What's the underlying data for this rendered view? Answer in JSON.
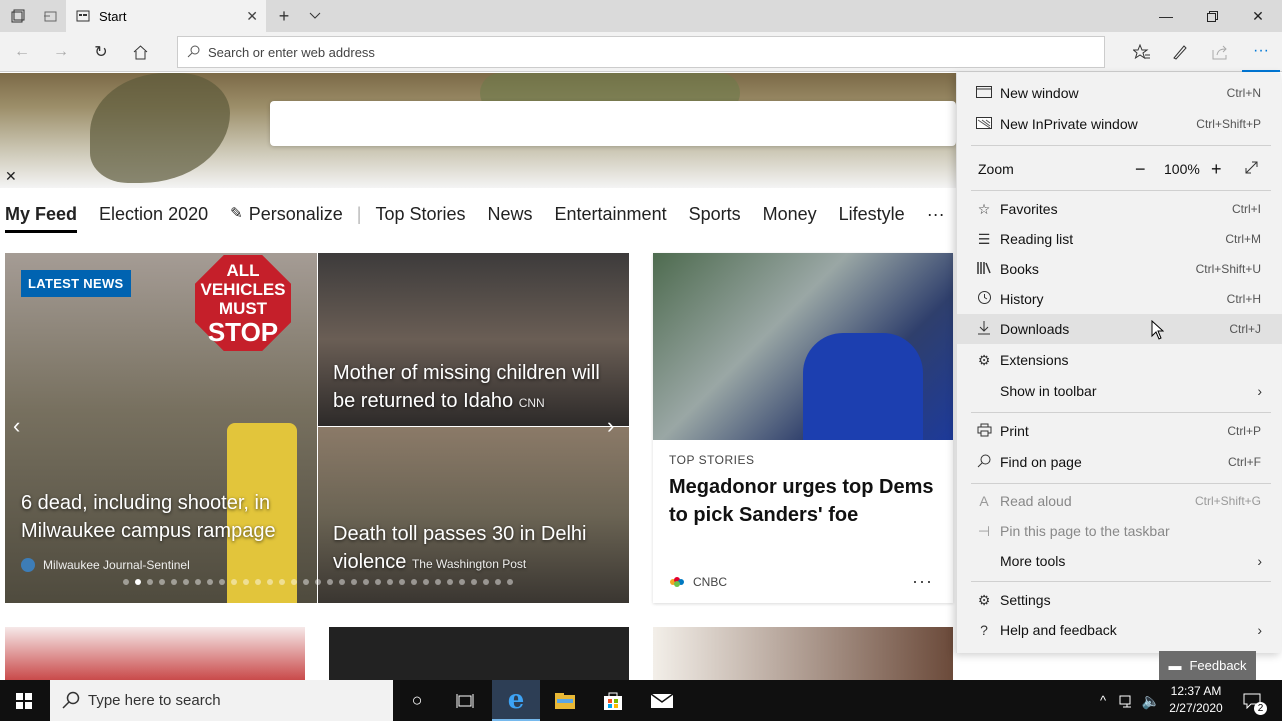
{
  "browser": {
    "tab_title": "Start",
    "address_placeholder": "Search or enter web address"
  },
  "feed": {
    "tabs": [
      "My Feed",
      "Election 2020",
      "Personalize",
      "Top Stories",
      "News",
      "Entertainment",
      "Sports",
      "Money",
      "Lifestyle",
      "···"
    ],
    "carousel": {
      "badge": "LATEST NEWS",
      "story1_title": "6 dead, including shooter, in Milwaukee campus rampage",
      "story1_source": "Milwaukee Journal-Sentinel",
      "story2_title": "Mother of missing children will be returned to Idaho",
      "story2_source": "CNN",
      "story3_title": "Death toll passes 30 in Delhi violence",
      "story3_source": "The Washington Post",
      "sign_line1": "ALL",
      "sign_line2": "VEHICLES",
      "sign_line3": "MUST",
      "sign_line4": "STOP"
    },
    "card": {
      "kicker": "TOP STORIES",
      "title": "Megadonor urges top Dems to pick Sanders' foe",
      "source": "CNBC",
      "more": "···"
    }
  },
  "menu": {
    "new_window": "New window",
    "new_window_sc": "Ctrl+N",
    "new_inprivate": "New InPrivate window",
    "new_inprivate_sc": "Ctrl+Shift+P",
    "zoom": "Zoom",
    "zoom_value": "100%",
    "favorites": "Favorites",
    "favorites_sc": "Ctrl+I",
    "reading_list": "Reading list",
    "reading_list_sc": "Ctrl+M",
    "books": "Books",
    "books_sc": "Ctrl+Shift+U",
    "history": "History",
    "history_sc": "Ctrl+H",
    "downloads": "Downloads",
    "downloads_sc": "Ctrl+J",
    "extensions": "Extensions",
    "show_in_toolbar": "Show in toolbar",
    "print": "Print",
    "print_sc": "Ctrl+P",
    "find": "Find on page",
    "find_sc": "Ctrl+F",
    "read_aloud": "Read aloud",
    "read_aloud_sc": "Ctrl+Shift+G",
    "pin": "Pin this page to the taskbar",
    "more_tools": "More tools",
    "settings": "Settings",
    "help": "Help and feedback"
  },
  "feedback_label": "Feedback",
  "taskbar": {
    "search_placeholder": "Type here to search",
    "time": "12:37 AM",
    "date": "2/27/2020",
    "notifications": "2"
  }
}
